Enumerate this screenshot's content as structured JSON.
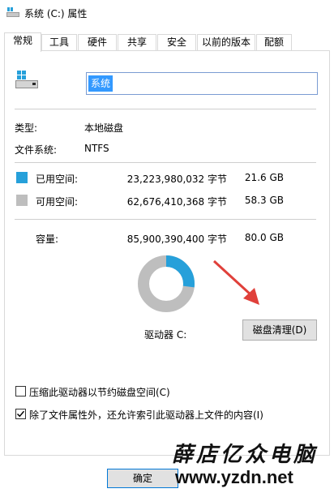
{
  "window": {
    "title": "系统 (C:) 属性"
  },
  "tabs": [
    {
      "label": "常规",
      "active": true
    },
    {
      "label": "工具",
      "active": false
    },
    {
      "label": "硬件",
      "active": false
    },
    {
      "label": "共享",
      "active": false
    },
    {
      "label": "安全",
      "active": false
    },
    {
      "label": "以前的版本",
      "active": false
    },
    {
      "label": "配额",
      "active": false
    }
  ],
  "general": {
    "drive_name": "系统",
    "type_label": "类型:",
    "type_value": "本地磁盘",
    "fs_label": "文件系统:",
    "fs_value": "NTFS",
    "used": {
      "label": "已用空间:",
      "bytes": "23,223,980,032 字节",
      "size": "21.6 GB",
      "color": "#26a0da"
    },
    "free": {
      "label": "可用空间:",
      "bytes": "62,676,410,368 字节",
      "size": "58.3 GB",
      "color": "#bebebe"
    },
    "capacity": {
      "label": "容量:",
      "bytes": "85,900,390,400 字节",
      "size": "80.0 GB"
    },
    "used_fraction": 0.27,
    "drive_label": "驱动器 C:",
    "cleanup_button": "磁盘清理(D)",
    "compress_checkbox": {
      "label": "压缩此驱动器以节约磁盘空间(C)",
      "checked": false
    },
    "index_checkbox": {
      "label": "除了文件属性外，还允许索引此驱动器上文件的内容(I)",
      "checked": true
    }
  },
  "footer": {
    "ok_button": "确定"
  },
  "watermark": {
    "title": "薛店亿众电脑",
    "url": "www.yzdn.net"
  },
  "colors": {
    "accent": "#26a0da",
    "free": "#bebebe",
    "arrow": "#e0403a",
    "selection": "#3399ff"
  }
}
